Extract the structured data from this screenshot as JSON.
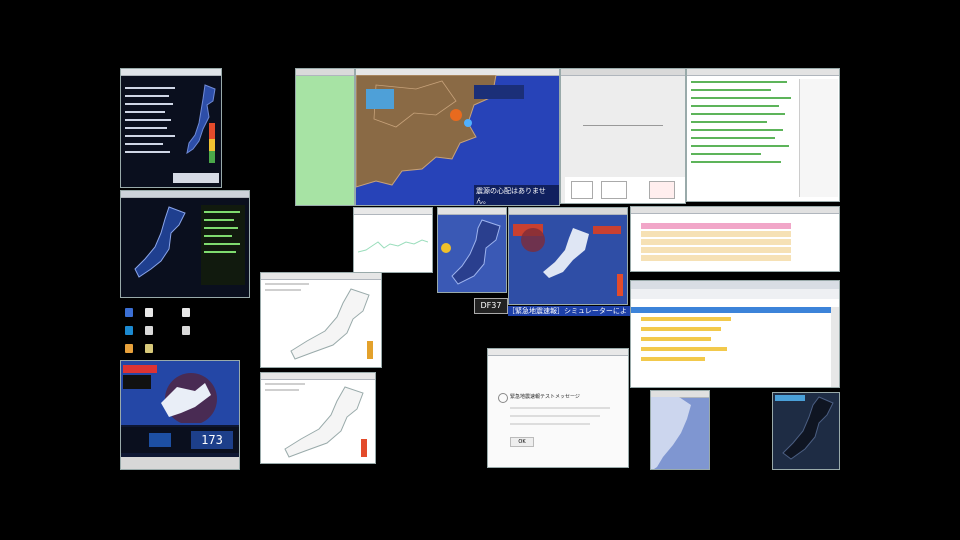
{
  "kanto_map": {
    "overlay_text": "震源の心配はありません。"
  },
  "counter_window": {
    "value": "173"
  },
  "info_window": {
    "title": "緊急地震速報テストメッセージ",
    "button": "OK"
  },
  "tag_label": "DF37",
  "ticker_text": "［緊急地震速報］シミュレーターによるテスト",
  "colors": {
    "desktop": "#000000",
    "sea": "#2743b8",
    "land": "#8a6a45",
    "green_panel": "#a7e3a4",
    "map_blue": "#3a59b5"
  }
}
